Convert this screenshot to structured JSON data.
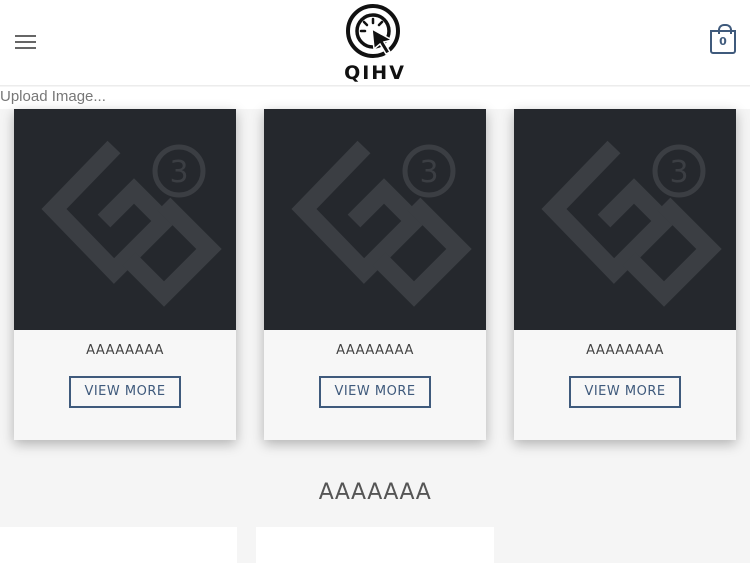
{
  "header": {
    "logo_text": "QIHV",
    "cart_count": "0"
  },
  "upload_label": "Upload Image...",
  "products": [
    {
      "title": "AAAAAAAA",
      "button_label": "VIEW MORE"
    },
    {
      "title": "AAAAAAAA",
      "button_label": "VIEW MORE"
    },
    {
      "title": "AAAAAAAA",
      "button_label": "VIEW MORE"
    }
  ],
  "section": {
    "title": "AAAAAAA"
  },
  "colors": {
    "accent": "#3f5a7c",
    "thumb_bg": "#25282d",
    "page_bg": "#f5f5f5"
  }
}
